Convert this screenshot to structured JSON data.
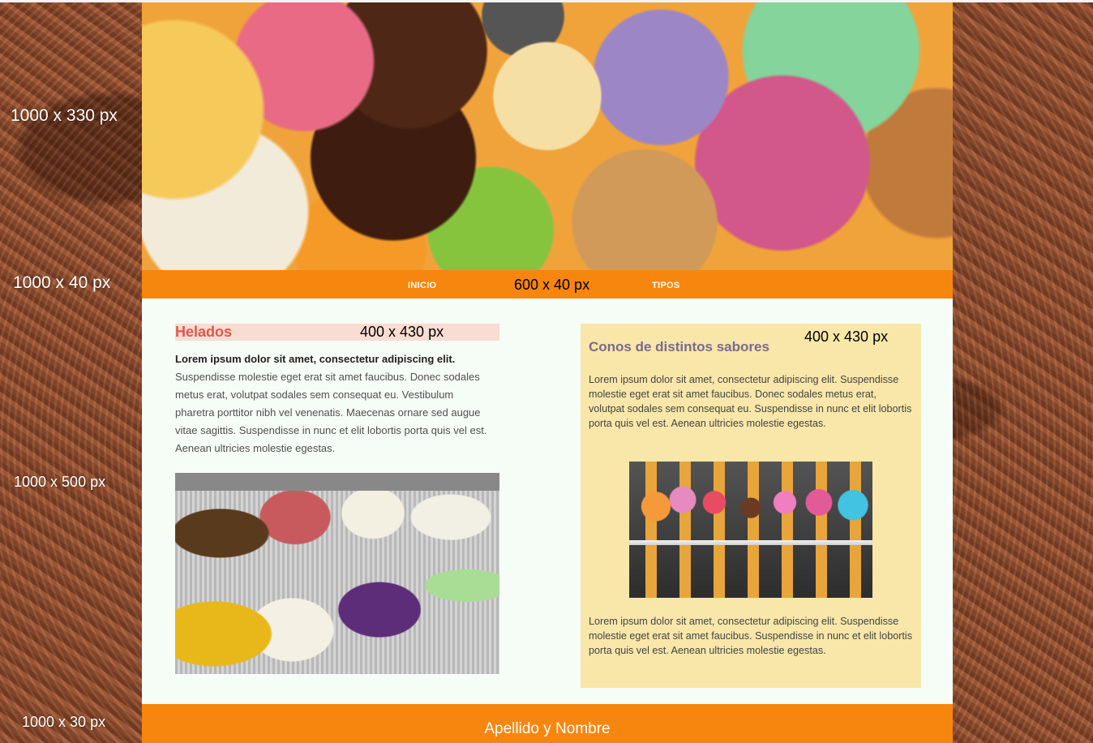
{
  "side_labels": {
    "banner_size": "1000 x 330 px",
    "nav_size": "1000 x 40 px",
    "content_size": "1000 x 500 px",
    "footer_size": "1000 x 30 px"
  },
  "nav": {
    "items": [
      {
        "label": "INICIO"
      },
      {
        "label": "TIPOS"
      }
    ],
    "size_label": "600 x 40 px"
  },
  "left_column": {
    "title": "Helados",
    "size_label": "400 x 430 px",
    "intro_bold": "Lorem ipsum dolor sit amet, consectetur adipiscing elit.",
    "body": "Suspendisse molestie eget erat sit amet faucibus. Donec sodales metus erat, volutpat sodales sem consequat eu. Vestibulum pharetra porttitor nibh vel venenatis. Maecenas ornare sed augue vitae sagittis. Suspendisse in nunc et elit lobortis porta quis vel est. Aenean ultricies molestie egestas."
  },
  "right_column": {
    "title": "Conos de distintos sabores",
    "size_label": "400 x 430 px",
    "paragraph_1": "Lorem ipsum dolor sit amet, consectetur adipiscing elit. Suspendisse molestie eget erat sit amet faucibus. Donec sodales metus erat, volutpat sodales sem consequat eu. Suspendisse in nunc et elit lobortis porta quis vel est. Aenean ultricies molestie egestas.",
    "paragraph_2": "Lorem ipsum dolor sit amet, consectetur adipiscing elit. Suspendisse molestie eget erat sit amet faucibus. Suspendisse in nunc et elit lobortis porta quis vel est. Aenean ultricies molestie egestas."
  },
  "footer": {
    "text": "Apellido y Nombre"
  },
  "colors": {
    "accent_orange": "#f7860f",
    "left_title": "#e2574c",
    "left_title_bg": "#f9dcd2",
    "right_panel_bg": "#f8e7a9",
    "right_title": "#7b6a8c",
    "content_bg": "#f6fcf6"
  }
}
